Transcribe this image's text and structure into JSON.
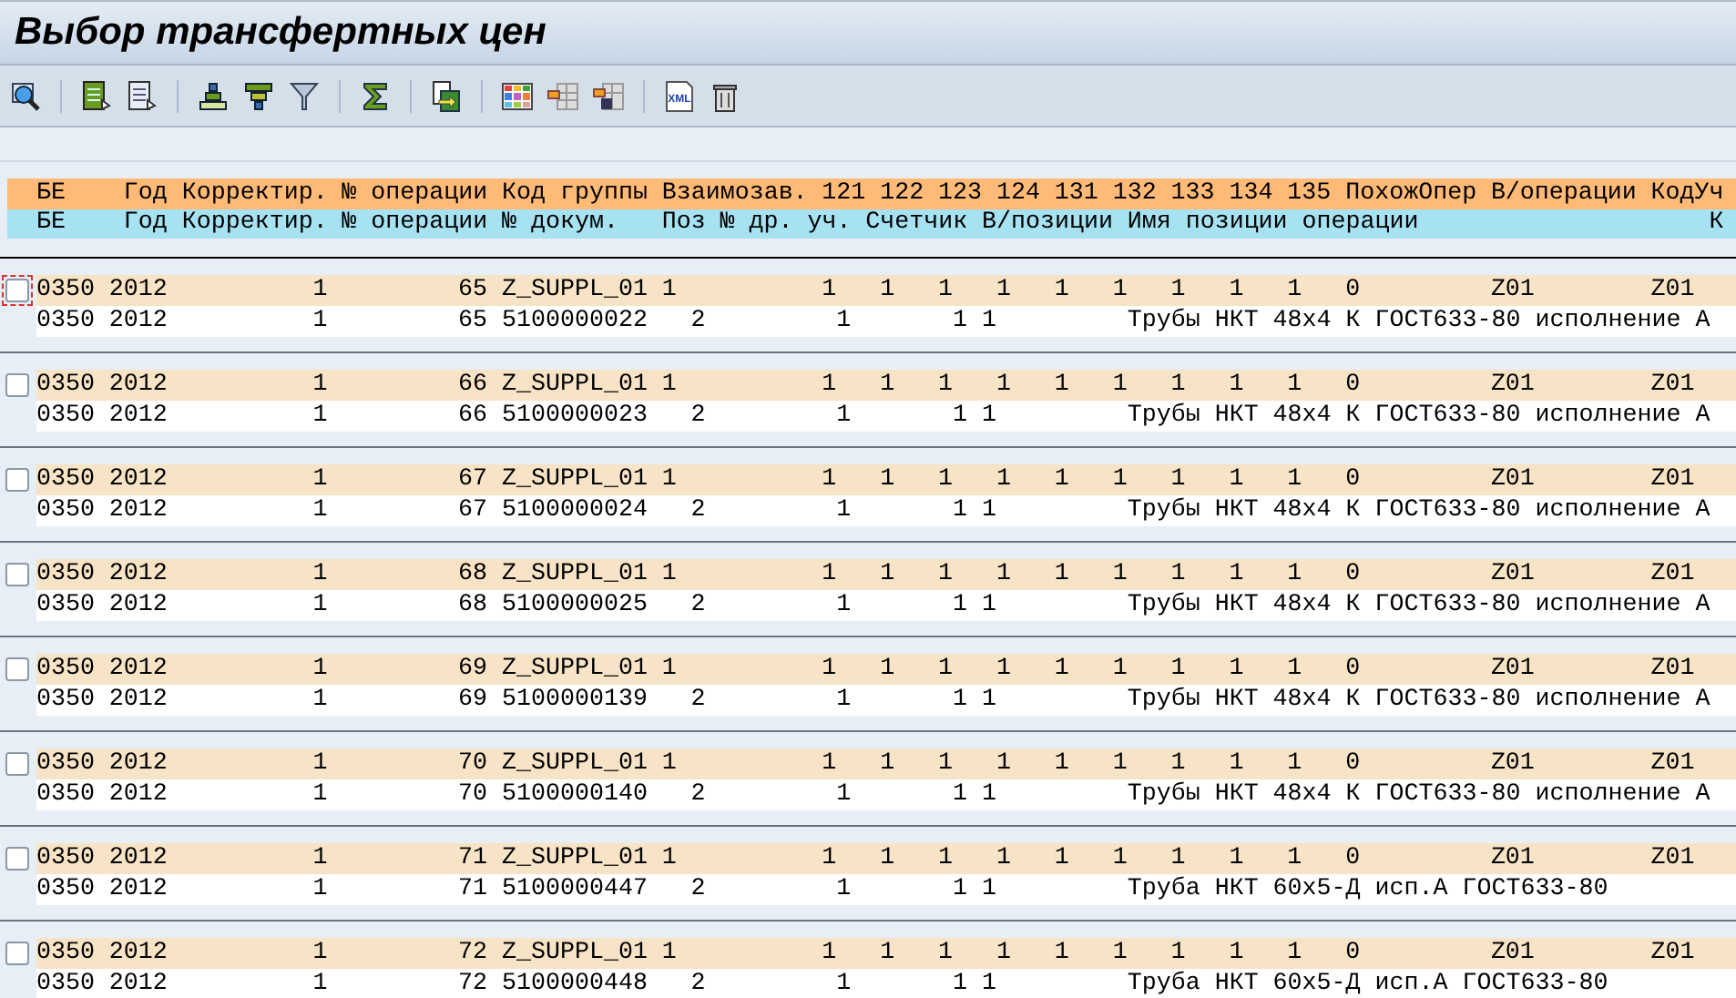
{
  "title": "Выбор трансфертных цен",
  "toolbar": [
    {
      "items": [
        {
          "kind": "details"
        }
      ]
    },
    {
      "items": [
        {
          "kind": "layout-green"
        },
        {
          "kind": "layout-doc"
        }
      ]
    },
    {
      "items": [
        {
          "kind": "sort-up"
        },
        {
          "kind": "sort-down"
        },
        {
          "kind": "filter"
        }
      ]
    },
    {
      "items": [
        {
          "kind": "sum"
        }
      ]
    },
    {
      "items": [
        {
          "kind": "export"
        }
      ]
    },
    {
      "items": [
        {
          "kind": "grid-color"
        },
        {
          "kind": "grid-col"
        },
        {
          "kind": "grid-save"
        }
      ]
    },
    {
      "items": [
        {
          "kind": "xml"
        },
        {
          "kind": "trash"
        }
      ]
    }
  ],
  "xml_icon_label": "XML",
  "header_1": [
    "БЕ",
    "Год",
    "Корректир.",
    "№ операции",
    "Код группы",
    "Взаимозав.",
    "121",
    "122",
    "123",
    "124",
    "131",
    "132",
    "133",
    "134",
    "135",
    "ПохожОпер",
    "В/операции",
    "КодУч"
  ],
  "header_2": [
    "БЕ",
    "Год",
    "Корректир.",
    "№ операции",
    "№ докум.",
    "Поз",
    "№ др. уч.",
    "Счетчик",
    "В/позиции",
    "Имя позиции операции",
    "К"
  ],
  "groups": [
    {
      "selected": false,
      "focused": true,
      "row_1": [
        "0350",
        "2012",
        "1",
        "65",
        "Z_SUPPL_01",
        "1",
        "1",
        "1",
        "1",
        "1",
        "1",
        "1",
        "1",
        "1",
        "1",
        "0",
        "Z01",
        "Z01"
      ],
      "row_2": [
        "0350",
        "2012",
        "1",
        "65",
        "5100000022",
        "2",
        "1",
        "1",
        "1",
        "Трубы НКТ 48х4 К ГОСТ633-80 исполнение А"
      ]
    },
    {
      "selected": false,
      "focused": false,
      "row_1": [
        "0350",
        "2012",
        "1",
        "66",
        "Z_SUPPL_01",
        "1",
        "1",
        "1",
        "1",
        "1",
        "1",
        "1",
        "1",
        "1",
        "1",
        "0",
        "Z01",
        "Z01"
      ],
      "row_2": [
        "0350",
        "2012",
        "1",
        "66",
        "5100000023",
        "2",
        "1",
        "1",
        "1",
        "Трубы НКТ 48х4 К ГОСТ633-80 исполнение А"
      ]
    },
    {
      "selected": false,
      "focused": false,
      "row_1": [
        "0350",
        "2012",
        "1",
        "67",
        "Z_SUPPL_01",
        "1",
        "1",
        "1",
        "1",
        "1",
        "1",
        "1",
        "1",
        "1",
        "1",
        "0",
        "Z01",
        "Z01"
      ],
      "row_2": [
        "0350",
        "2012",
        "1",
        "67",
        "5100000024",
        "2",
        "1",
        "1",
        "1",
        "Трубы НКТ 48х4 К ГОСТ633-80 исполнение А"
      ]
    },
    {
      "selected": false,
      "focused": false,
      "row_1": [
        "0350",
        "2012",
        "1",
        "68",
        "Z_SUPPL_01",
        "1",
        "1",
        "1",
        "1",
        "1",
        "1",
        "1",
        "1",
        "1",
        "1",
        "0",
        "Z01",
        "Z01"
      ],
      "row_2": [
        "0350",
        "2012",
        "1",
        "68",
        "5100000025",
        "2",
        "1",
        "1",
        "1",
        "Трубы НКТ 48х4 К ГОСТ633-80 исполнение А"
      ]
    },
    {
      "selected": false,
      "focused": false,
      "row_1": [
        "0350",
        "2012",
        "1",
        "69",
        "Z_SUPPL_01",
        "1",
        "1",
        "1",
        "1",
        "1",
        "1",
        "1",
        "1",
        "1",
        "1",
        "0",
        "Z01",
        "Z01"
      ],
      "row_2": [
        "0350",
        "2012",
        "1",
        "69",
        "5100000139",
        "2",
        "1",
        "1",
        "1",
        "Трубы НКТ 48х4 К ГОСТ633-80 исполнение А"
      ]
    },
    {
      "selected": false,
      "focused": false,
      "row_1": [
        "0350",
        "2012",
        "1",
        "70",
        "Z_SUPPL_01",
        "1",
        "1",
        "1",
        "1",
        "1",
        "1",
        "1",
        "1",
        "1",
        "1",
        "0",
        "Z01",
        "Z01"
      ],
      "row_2": [
        "0350",
        "2012",
        "1",
        "70",
        "5100000140",
        "2",
        "1",
        "1",
        "1",
        "Трубы НКТ 48х4 К ГОСТ633-80 исполнение А"
      ]
    },
    {
      "selected": false,
      "focused": false,
      "row_1": [
        "0350",
        "2012",
        "1",
        "71",
        "Z_SUPPL_01",
        "1",
        "1",
        "1",
        "1",
        "1",
        "1",
        "1",
        "1",
        "1",
        "1",
        "0",
        "Z01",
        "Z01"
      ],
      "row_2": [
        "0350",
        "2012",
        "1",
        "71",
        "5100000447",
        "2",
        "1",
        "1",
        "1",
        "Труба НКТ 60х5-Д исп.А ГОСТ633-80"
      ]
    },
    {
      "selected": false,
      "focused": false,
      "row_1": [
        "0350",
        "2012",
        "1",
        "72",
        "Z_SUPPL_01",
        "1",
        "1",
        "1",
        "1",
        "1",
        "1",
        "1",
        "1",
        "1",
        "1",
        "0",
        "Z01",
        "Z01"
      ],
      "row_2": [
        "0350",
        "2012",
        "1",
        "72",
        "5100000448",
        "2",
        "1",
        "1",
        "1",
        "Труба НКТ 60х5-Д исп.А ГОСТ633-80"
      ]
    }
  ]
}
